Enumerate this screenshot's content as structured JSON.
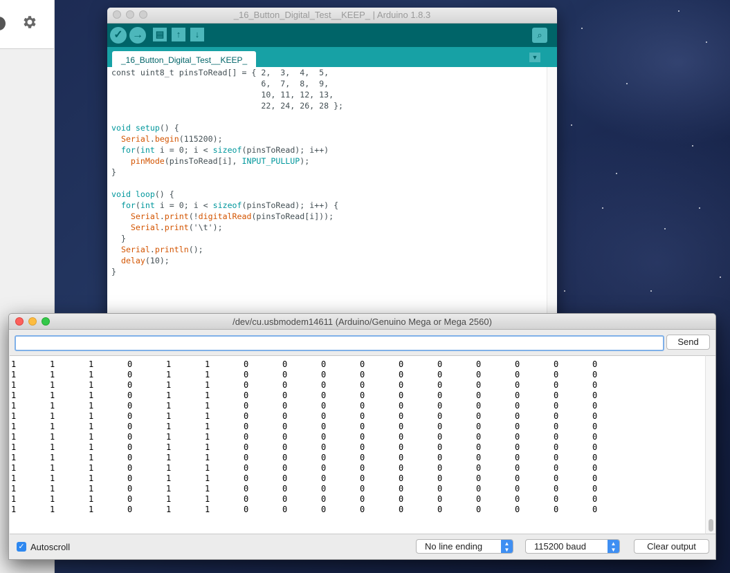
{
  "ide": {
    "title": "_16_Button_Digital_Test__KEEP_ | Arduino 1.8.3",
    "tab_label": "_16_Button_Digital_Test__KEEP_",
    "toolbar": {
      "verify_icon": "check-icon",
      "upload_icon": "arrow-right-icon",
      "new_icon": "document-icon",
      "open_icon": "arrow-up-icon",
      "save_icon": "arrow-down-icon",
      "serial_monitor_icon": "magnifier-icon"
    }
  },
  "serial": {
    "title": "/dev/cu.usbmodem14611 (Arduino/Genuino Mega or Mega 2560)",
    "input_value": "",
    "send_label": "Send",
    "output_rows": [
      [
        "1",
        "1",
        "1",
        "0",
        "1",
        "1",
        "0",
        "0",
        "0",
        "0",
        "0",
        "0",
        "0",
        "0",
        "0",
        "0"
      ],
      [
        "1",
        "1",
        "1",
        "0",
        "1",
        "1",
        "0",
        "0",
        "0",
        "0",
        "0",
        "0",
        "0",
        "0",
        "0",
        "0"
      ],
      [
        "1",
        "1",
        "1",
        "0",
        "1",
        "1",
        "0",
        "0",
        "0",
        "0",
        "0",
        "0",
        "0",
        "0",
        "0",
        "0"
      ],
      [
        "1",
        "1",
        "1",
        "0",
        "1",
        "1",
        "0",
        "0",
        "0",
        "0",
        "0",
        "0",
        "0",
        "0",
        "0",
        "0"
      ],
      [
        "1",
        "1",
        "1",
        "0",
        "1",
        "1",
        "0",
        "0",
        "0",
        "0",
        "0",
        "0",
        "0",
        "0",
        "0",
        "0"
      ],
      [
        "1",
        "1",
        "1",
        "0",
        "1",
        "1",
        "0",
        "0",
        "0",
        "0",
        "0",
        "0",
        "0",
        "0",
        "0",
        "0"
      ],
      [
        "1",
        "1",
        "1",
        "0",
        "1",
        "1",
        "0",
        "0",
        "0",
        "0",
        "0",
        "0",
        "0",
        "0",
        "0",
        "0"
      ],
      [
        "1",
        "1",
        "1",
        "0",
        "1",
        "1",
        "0",
        "0",
        "0",
        "0",
        "0",
        "0",
        "0",
        "0",
        "0",
        "0"
      ],
      [
        "1",
        "1",
        "1",
        "0",
        "1",
        "1",
        "0",
        "0",
        "0",
        "0",
        "0",
        "0",
        "0",
        "0",
        "0",
        "0"
      ],
      [
        "1",
        "1",
        "1",
        "0",
        "1",
        "1",
        "0",
        "0",
        "0",
        "0",
        "0",
        "0",
        "0",
        "0",
        "0",
        "0"
      ],
      [
        "1",
        "1",
        "1",
        "0",
        "1",
        "1",
        "0",
        "0",
        "0",
        "0",
        "0",
        "0",
        "0",
        "0",
        "0",
        "0"
      ],
      [
        "1",
        "1",
        "1",
        "0",
        "1",
        "1",
        "0",
        "0",
        "0",
        "0",
        "0",
        "0",
        "0",
        "0",
        "0",
        "0"
      ],
      [
        "1",
        "1",
        "1",
        "0",
        "1",
        "1",
        "0",
        "0",
        "0",
        "0",
        "0",
        "0",
        "0",
        "0",
        "0",
        "0"
      ],
      [
        "1",
        "1",
        "1",
        "0",
        "1",
        "1",
        "0",
        "0",
        "0",
        "0",
        "0",
        "0",
        "0",
        "0",
        "0",
        "0"
      ],
      [
        "1",
        "1",
        "1",
        "0",
        "1",
        "1",
        "0",
        "0",
        "0",
        "0",
        "0",
        "0",
        "0",
        "0",
        "0",
        "0"
      ]
    ],
    "autoscroll_label": "Autoscroll",
    "autoscroll_checked": true,
    "line_ending": "No line ending",
    "baud": "115200 baud",
    "clear_label": "Clear output"
  },
  "colors": {
    "arduino_dark_teal": "#006468",
    "arduino_teal": "#17a1a5",
    "keyword": "#00979c",
    "function": "#d35400",
    "accent_blue": "#3f8ff2"
  }
}
